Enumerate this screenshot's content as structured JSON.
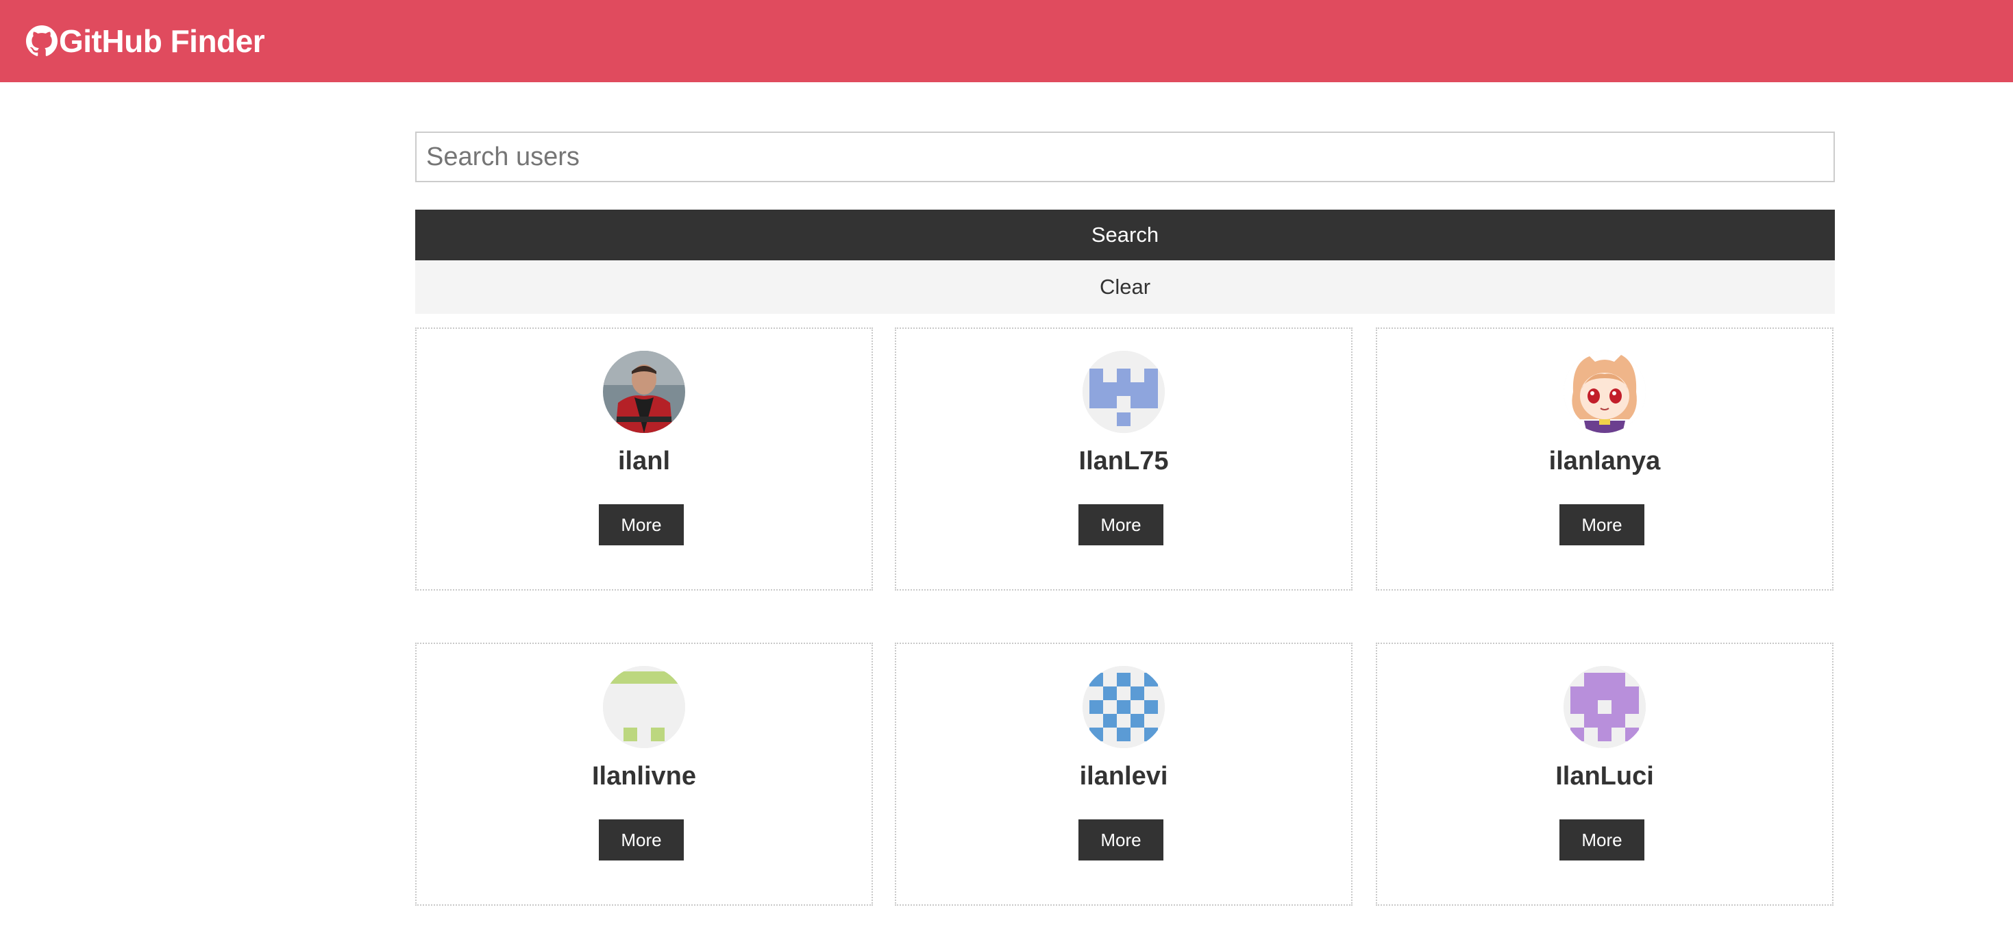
{
  "navbar": {
    "title": "GitHub Finder",
    "icon": "github-icon",
    "background": "#e04b5e"
  },
  "search": {
    "placeholder": "Search users",
    "value": "",
    "search_label": "Search",
    "clear_label": "Clear"
  },
  "users": [
    {
      "login": "ilanl",
      "more_label": "More",
      "avatar": "photo-avatar"
    },
    {
      "login": "IlanL75",
      "more_label": "More",
      "avatar": "identicon-blue"
    },
    {
      "login": "ilanlanya",
      "more_label": "More",
      "avatar": "anime-avatar"
    },
    {
      "login": "Ilanlivne",
      "more_label": "More",
      "avatar": "identicon-green"
    },
    {
      "login": "ilanlevi",
      "more_label": "More",
      "avatar": "identicon-lightblue"
    },
    {
      "login": "IlanLuci",
      "more_label": "More",
      "avatar": "identicon-purple"
    }
  ]
}
